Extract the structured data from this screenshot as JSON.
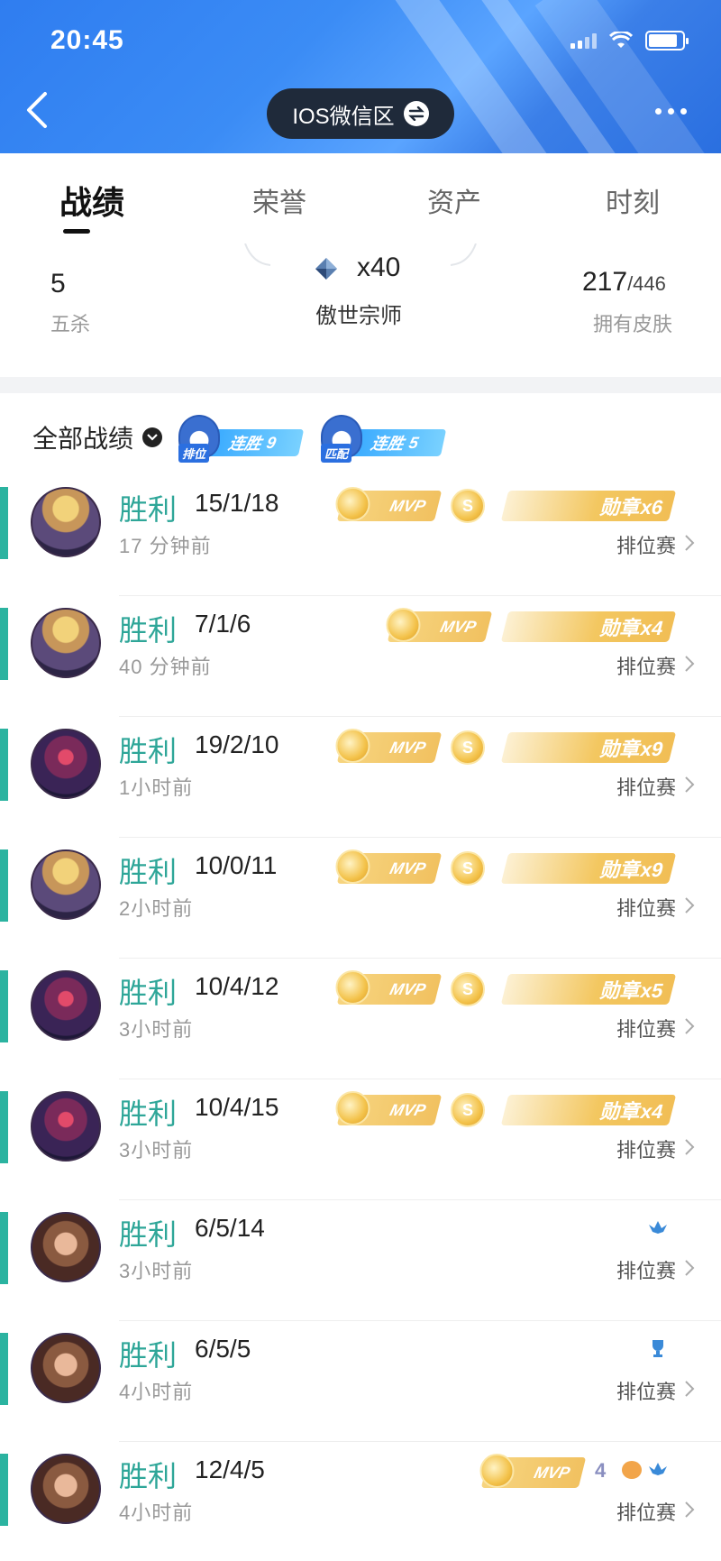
{
  "status_bar": {
    "time": "20:45"
  },
  "header": {
    "server": "IOS微信区"
  },
  "tabs": [
    "战绩",
    "荣誉",
    "资产",
    "时刻"
  ],
  "stats": {
    "pentakills": {
      "value": "5",
      "label": "五杀"
    },
    "rank": {
      "value": "x40",
      "label": "傲世宗师"
    },
    "skins": {
      "owned": "217",
      "total": "/446",
      "label": "拥有皮肤"
    }
  },
  "filter": {
    "label": "全部战绩",
    "streaks": [
      {
        "mode": "排位",
        "text": "连胜",
        "count": "9"
      },
      {
        "mode": "匹配",
        "text": "连胜",
        "count": "5"
      }
    ]
  },
  "matches": [
    {
      "result": "胜利",
      "kda": "15/1/18",
      "time": "17 分钟前",
      "mode": "排位赛",
      "mvp": "MVP",
      "medal": "勋章x6",
      "hero": "a"
    },
    {
      "result": "胜利",
      "kda": "7/1/6",
      "time": "40 分钟前",
      "mode": "排位赛",
      "mvp": "MVP",
      "medal": "勋章x4",
      "hero": "a"
    },
    {
      "result": "胜利",
      "kda": "19/2/10",
      "time": "1小时前",
      "mode": "排位赛",
      "mvp": "MVP",
      "medal": "勋章x9",
      "hero": "b"
    },
    {
      "result": "胜利",
      "kda": "10/0/11",
      "time": "2小时前",
      "mode": "排位赛",
      "mvp": "MVP",
      "medal": "勋章x9",
      "hero": "a"
    },
    {
      "result": "胜利",
      "kda": "10/4/12",
      "time": "3小时前",
      "mode": "排位赛",
      "mvp": "MVP",
      "medal": "勋章x5",
      "hero": "b"
    },
    {
      "result": "胜利",
      "kda": "10/4/15",
      "time": "3小时前",
      "mode": "排位赛",
      "mvp": "MVP",
      "medal": "勋章x4",
      "hero": "b"
    },
    {
      "result": "胜利",
      "kda": "6/5/14",
      "time": "3小时前",
      "mode": "排位赛",
      "hero": "c"
    },
    {
      "result": "胜利",
      "kda": "6/5/5",
      "time": "4小时前",
      "mode": "排位赛",
      "hero": "c"
    },
    {
      "result": "胜利",
      "kda": "12/4/5",
      "time": "4小时前",
      "mode": "排位赛",
      "mvp": "MVP",
      "extra_num": "4",
      "hero": "c"
    }
  ],
  "colors": {
    "accent": "#2bb3a0",
    "header_blue": "#3b8cf5",
    "gold": "#f3c760"
  }
}
